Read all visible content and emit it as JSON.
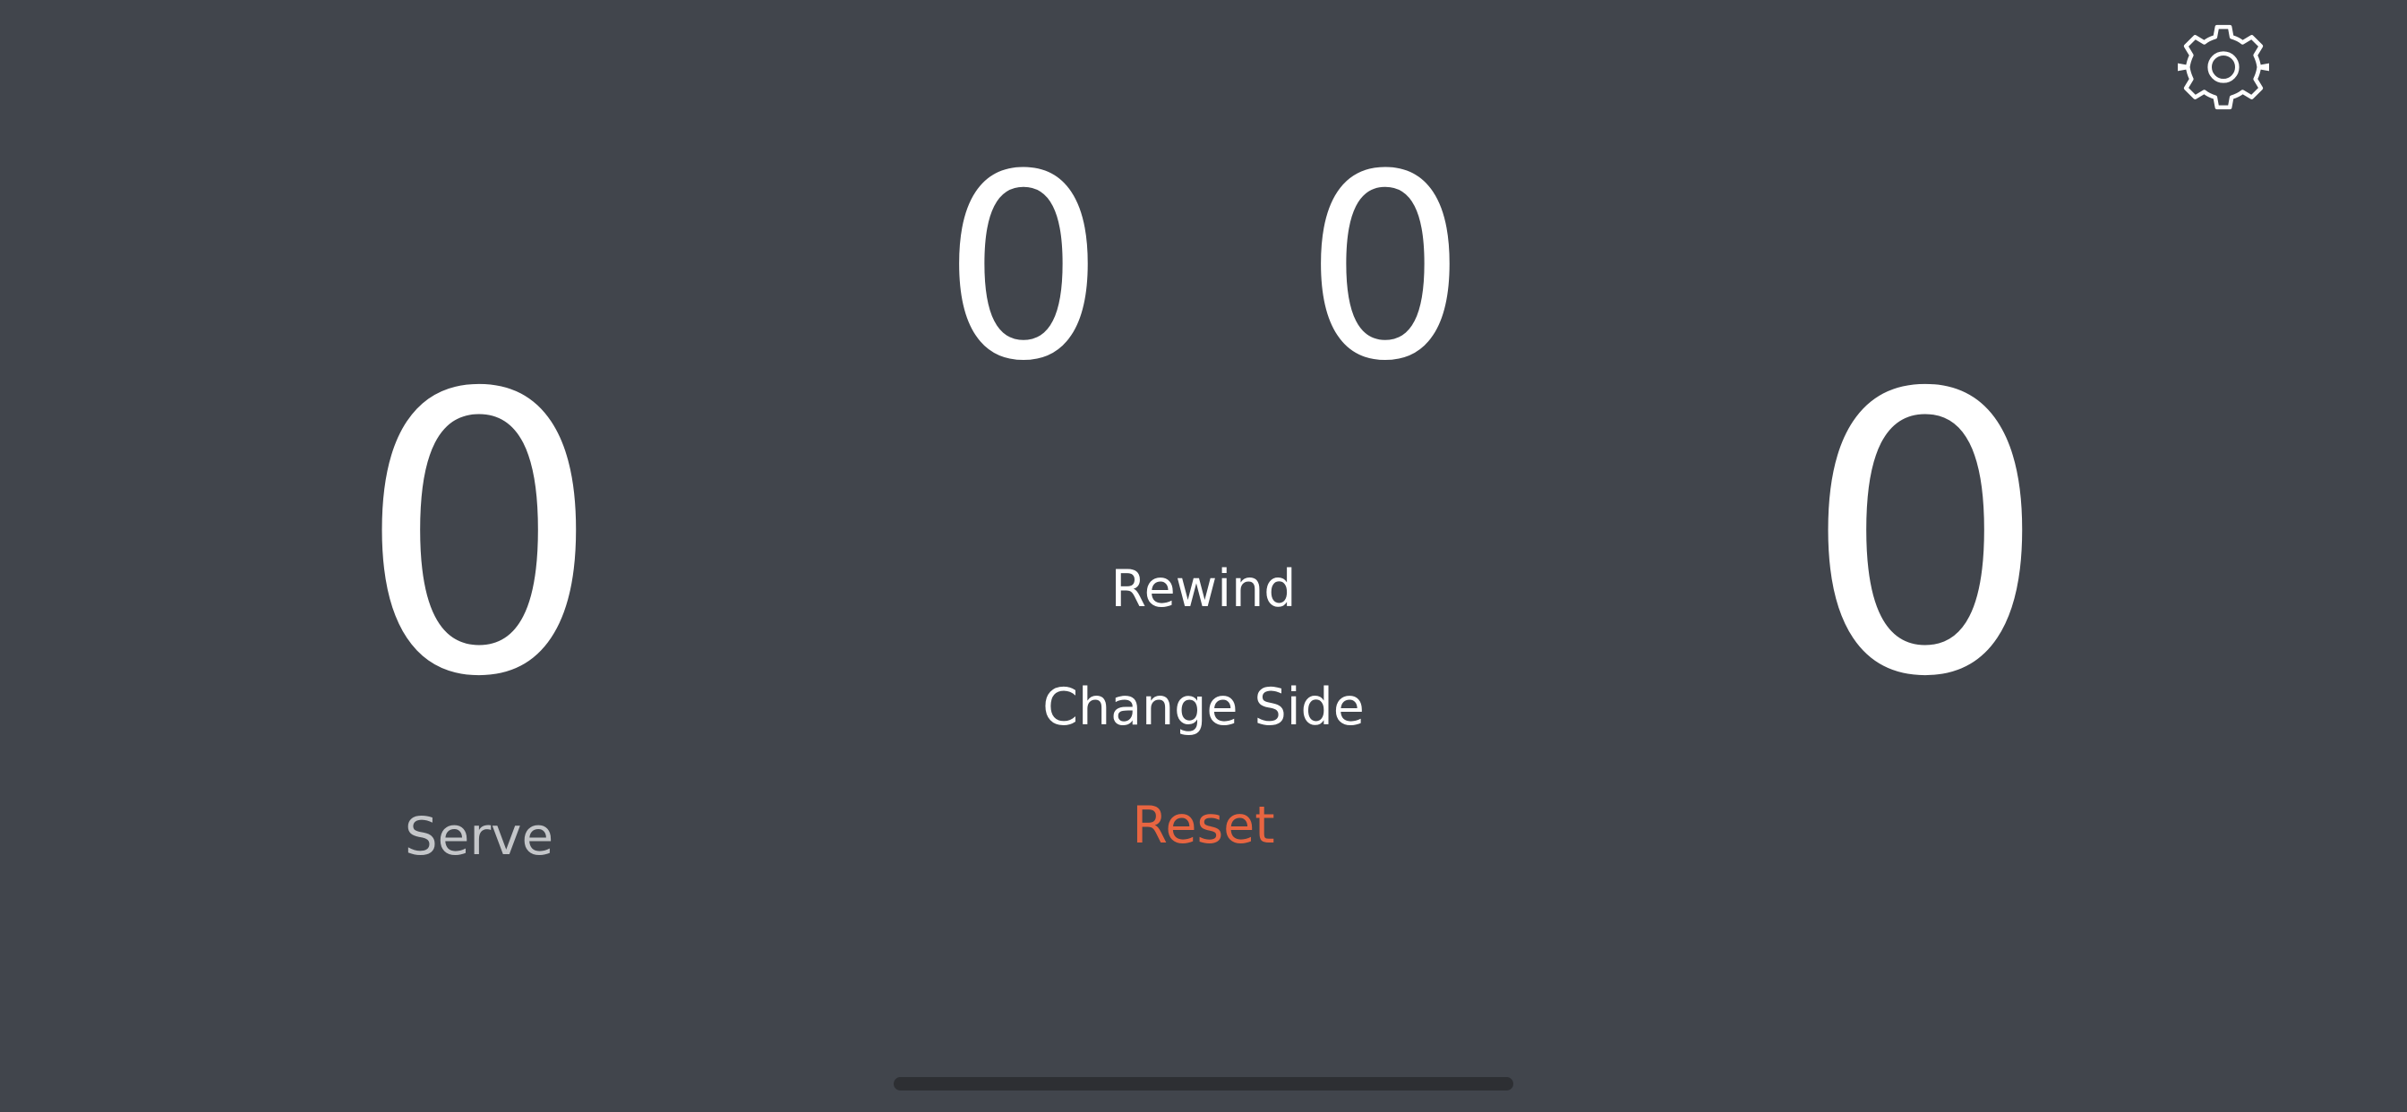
{
  "settings": {
    "icon": "gear-icon"
  },
  "scoreboard": {
    "left_points": "0",
    "right_points": "0",
    "left_games": "0",
    "right_games": "0"
  },
  "serve_label": "Serve",
  "actions": {
    "rewind": "Rewind",
    "change_side": "Change Side",
    "reset": "Reset"
  },
  "colors": {
    "background": "#41454c",
    "text": "#ffffff",
    "serve_text": "#c4c6c9",
    "reset": "#e86541"
  }
}
